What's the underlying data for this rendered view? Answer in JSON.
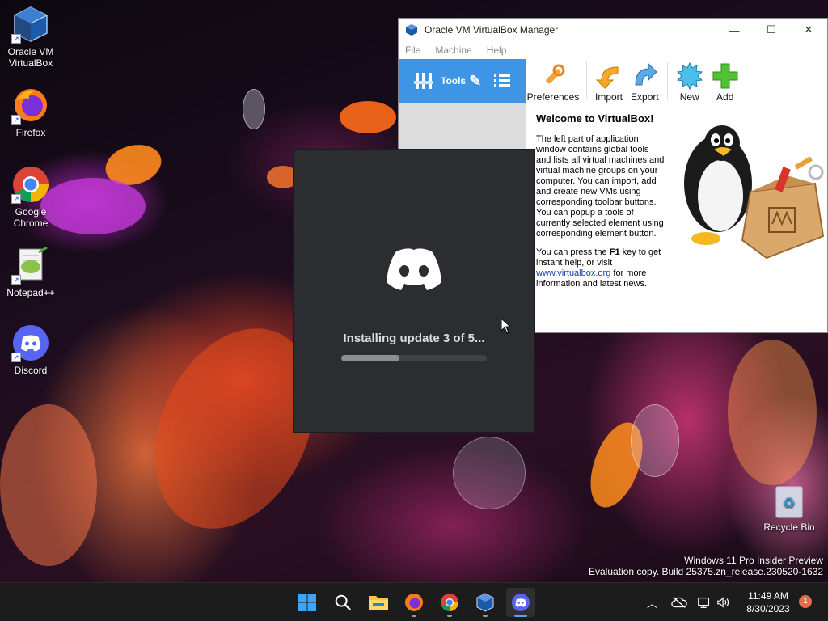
{
  "desktop": {
    "icons": [
      {
        "label_line1": "Oracle VM",
        "label_line2": "VirtualBox"
      },
      {
        "label_line1": "Firefox",
        "label_line2": ""
      },
      {
        "label_line1": "Google",
        "label_line2": "Chrome"
      },
      {
        "label_line1": "Notepad++",
        "label_line2": ""
      },
      {
        "label_line1": "Discord",
        "label_line2": ""
      },
      {
        "label_line1": "Recycle Bin",
        "label_line2": ""
      }
    ]
  },
  "virtualbox": {
    "title": "Oracle VM VirtualBox Manager",
    "menu": [
      "File",
      "Machine",
      "Help"
    ],
    "tools_label": "Tools",
    "toolbar": {
      "preferences": "Preferences",
      "import": "Import",
      "export": "Export",
      "new": "New",
      "add": "Add"
    },
    "welcome": {
      "heading": "Welcome to VirtualBox!",
      "para1": "The left part of application window contains global tools and lists all virtual machines and virtual machine groups on your computer. You can import, add and create new VMs using corresponding toolbar buttons. You can popup a tools of currently selected element using corresponding element button.",
      "para2_before": "You can press the ",
      "para2_key": "F1",
      "para2_after": " key to get instant help, or visit",
      "link": "www.virtualbox.org",
      "para2_tail": " for more information and latest news."
    }
  },
  "discord_updater": {
    "status": "Installing update 3 of 5...",
    "progress": 0.4
  },
  "watermark": {
    "line1": "Windows 11 Pro Insider Preview",
    "line2": "Evaluation copy. Build 25375.zn_release.230520-1632"
  },
  "taskbar": {
    "time": "11:49 AM",
    "date": "8/30/2023",
    "notification_count": "1"
  },
  "colors": {
    "discord_bg": "#2b2d31",
    "discord_blurple": "#5865f2",
    "vbox_tools_blue": "#3e95e6",
    "taskbar_bg": "#1c1c1c"
  }
}
